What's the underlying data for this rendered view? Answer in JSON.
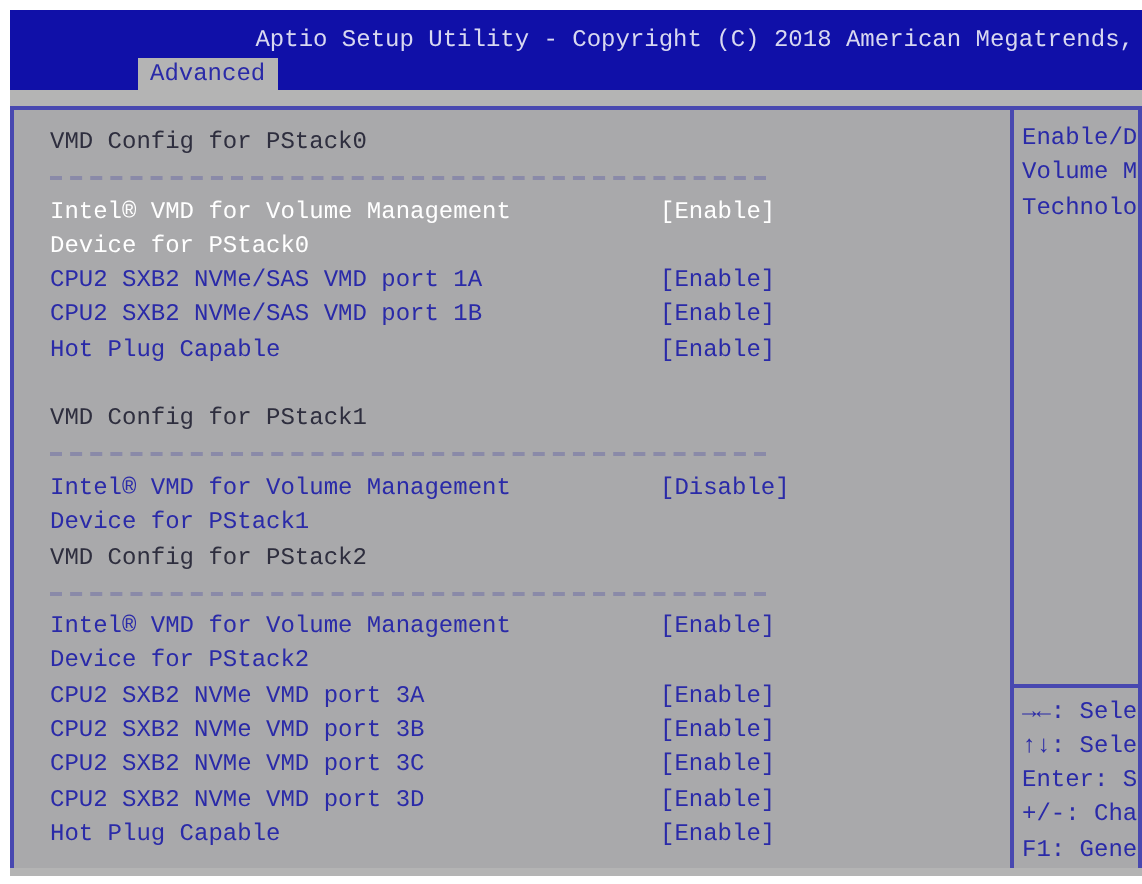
{
  "title": "Aptio Setup Utility - Copyright (C) 2018 American Megatrends,",
  "tabs": [
    {
      "label": "Advanced",
      "selected": true
    }
  ],
  "rows": [
    {
      "kind": "heading",
      "label": "VMD Config for PStack0"
    },
    {
      "kind": "separator"
    },
    {
      "kind": "setting",
      "label": "Intel® VMD for Volume Management",
      "label_2": "Device for PStack0",
      "value": "[Enable]",
      "selected": true
    },
    {
      "kind": "setting",
      "label": "CPU2 SXB2 NVMe/SAS VMD port 1A",
      "value": "[Enable]",
      "selected": false
    },
    {
      "kind": "setting",
      "label": "CPU2 SXB2 NVMe/SAS VMD port 1B",
      "value": "[Enable]",
      "selected": false
    },
    {
      "kind": "setting",
      "label": "Hot Plug Capable",
      "value": "[Enable]",
      "selected": false
    },
    {
      "kind": "spacer"
    },
    {
      "kind": "heading",
      "label": "VMD Config for PStack1"
    },
    {
      "kind": "separator"
    },
    {
      "kind": "setting",
      "label": "Intel® VMD for Volume Management",
      "label_2": "Device for PStack1",
      "value": "[Disable]",
      "selected": false
    },
    {
      "kind": "heading",
      "label": "VMD Config for PStack2"
    },
    {
      "kind": "separator"
    },
    {
      "kind": "setting",
      "label": "Intel® VMD for Volume Management",
      "label_2": "Device for PStack2",
      "value": "[Enable]",
      "selected": false
    },
    {
      "kind": "setting",
      "label": "CPU2 SXB2 NVMe VMD port 3A",
      "value": "[Enable]",
      "selected": false
    },
    {
      "kind": "setting",
      "label": "CPU2 SXB2 NVMe VMD port 3B",
      "value": "[Enable]",
      "selected": false
    },
    {
      "kind": "setting",
      "label": "CPU2 SXB2 NVMe VMD port 3C",
      "value": "[Enable]",
      "selected": false
    },
    {
      "kind": "setting",
      "label": "CPU2 SXB2 NVMe VMD port 3D",
      "value": "[Enable]",
      "selected": false
    },
    {
      "kind": "setting",
      "label": "Hot Plug Capable",
      "value": "[Enable]",
      "selected": false
    }
  ],
  "help": [
    "Enable/D",
    "Volume M",
    "Technolo"
  ],
  "keys": [
    "→←: Sele",
    "↑↓: Sele",
    "Enter: S",
    "+/-: Cha",
    "F1: Gene"
  ]
}
